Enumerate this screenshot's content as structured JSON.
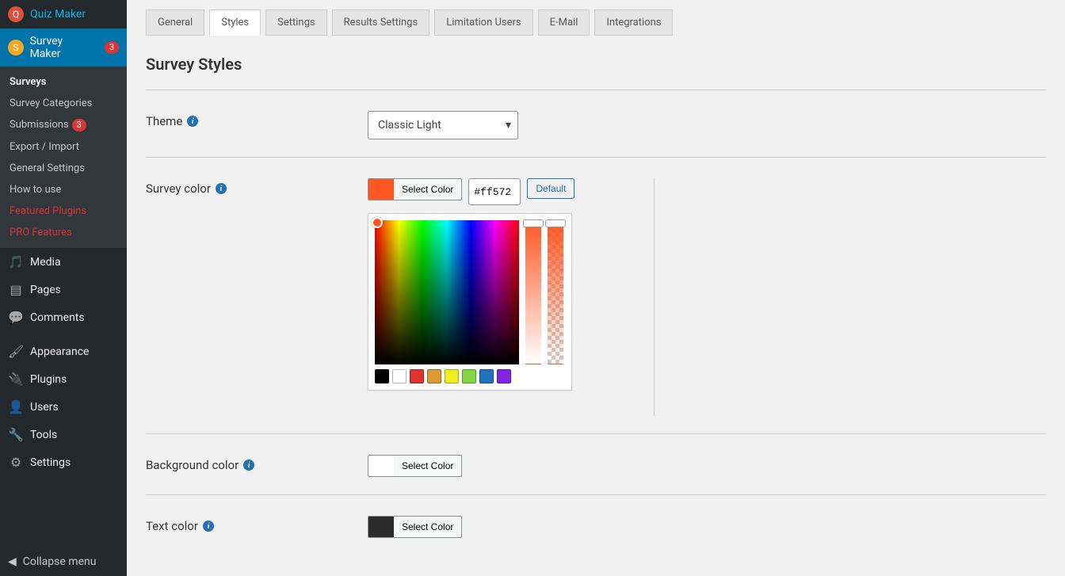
{
  "sidebar": {
    "quiz_maker": "Quiz Maker",
    "survey_maker": "Survey Maker",
    "survey_maker_badge": "3",
    "submenu": [
      {
        "label": "Surveys",
        "active": true
      },
      {
        "label": "Survey Categories"
      },
      {
        "label": "Submissions",
        "badge": "3"
      },
      {
        "label": "Export / Import"
      },
      {
        "label": "General Settings"
      },
      {
        "label": "How to use"
      },
      {
        "label": "Featured Plugins",
        "accent": true
      },
      {
        "label": "PRO Features",
        "accent": true
      }
    ],
    "media": "Media",
    "pages": "Pages",
    "comments": "Comments",
    "appearance": "Appearance",
    "plugins": "Plugins",
    "users": "Users",
    "tools": "Tools",
    "settings": "Settings",
    "collapse": "Collapse menu"
  },
  "tabs": [
    {
      "label": "General"
    },
    {
      "label": "Styles",
      "active": true
    },
    {
      "label": "Settings"
    },
    {
      "label": "Results Settings"
    },
    {
      "label": "Limitation Users"
    },
    {
      "label": "E-Mail"
    },
    {
      "label": "Integrations"
    }
  ],
  "page_title": "Survey Styles",
  "theme": {
    "label": "Theme",
    "value": "Classic Light"
  },
  "survey_color": {
    "label": "Survey color",
    "select_label": "Select Color",
    "hex": "#ff572",
    "default_label": "Default",
    "presets": [
      "#000000",
      "#ffffff",
      "#dd3333",
      "#dd9933",
      "#eeee22",
      "#81d742",
      "#1e73be",
      "#8224e3"
    ]
  },
  "background_color": {
    "label": "Background color",
    "select_label": "Select Color"
  },
  "text_color": {
    "label": "Text color",
    "select_label": "Select Color"
  }
}
